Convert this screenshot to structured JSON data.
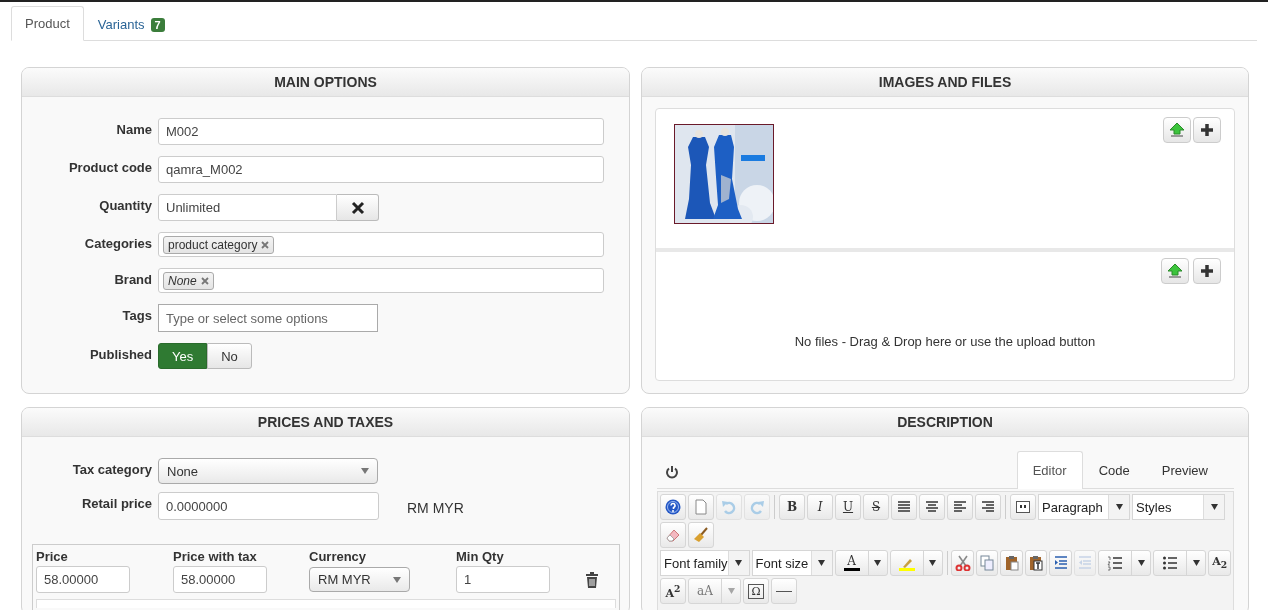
{
  "tabs": [
    {
      "label": "Product",
      "selected": true
    },
    {
      "label": "Variants",
      "selected": false,
      "badge": "7"
    }
  ],
  "main_options": {
    "title": "MAIN OPTIONS",
    "fields": [
      {
        "kind": "text",
        "label": "Name",
        "value": "M002"
      },
      {
        "kind": "text",
        "label": "Product code",
        "value": "qamra_M002"
      },
      {
        "kind": "clearable",
        "label": "Quantity",
        "value": "Unlimited"
      },
      {
        "kind": "tags",
        "label": "Categories",
        "tags": [
          {
            "text": "product category",
            "italic": false
          }
        ]
      },
      {
        "kind": "tags",
        "label": "Brand",
        "tags": [
          {
            "text": "None",
            "italic": true
          }
        ]
      },
      {
        "kind": "search",
        "label": "Tags",
        "placeholder": "Type or select some options"
      },
      {
        "kind": "toggle",
        "label": "Published",
        "options": [
          {
            "label": "Yes",
            "selected": true
          },
          {
            "label": "No",
            "selected": false
          }
        ]
      }
    ]
  },
  "images_and_files": {
    "title": "IMAGES AND FILES",
    "files_message": "No files - Drag & Drop here or use the upload button"
  },
  "prices_and_taxes": {
    "title": "PRICES AND TAXES",
    "tax_category": {
      "label": "Tax category",
      "value": "None"
    },
    "retail_price": {
      "label": "Retail price",
      "value": "0.0000000",
      "currency": "RM MYR"
    },
    "price_columns": [
      "Price",
      "Price with tax",
      "Currency",
      "Min Qty"
    ],
    "price_rows": [
      {
        "price": "58.00000",
        "price_with_tax": "58.00000",
        "currency": "RM MYR",
        "min_qty": "1"
      }
    ]
  },
  "description": {
    "title": "DESCRIPTION",
    "tabs": [
      {
        "label": "Editor",
        "selected": true
      },
      {
        "label": "Code",
        "selected": false
      },
      {
        "label": "Preview",
        "selected": false
      }
    ],
    "toolbar_lines": [
      [
        {
          "kind": "icon",
          "disabled": false
        },
        {
          "kind": "icon",
          "disabled": false
        },
        {
          "kind": "icon",
          "disabled": true
        },
        {
          "kind": "icon",
          "disabled": true
        },
        {
          "kind": "separator"
        },
        {
          "kind": "glyph",
          "text": "B",
          "disabled": false
        },
        {
          "kind": "glyph",
          "text": "I",
          "disabled": false
        },
        {
          "kind": "glyph",
          "text": "U",
          "disabled": false
        },
        {
          "kind": "glyph",
          "text": "S",
          "disabled": false
        },
        {
          "kind": "icon",
          "disabled": false
        },
        {
          "kind": "icon",
          "disabled": false
        },
        {
          "kind": "icon",
          "disabled": false
        },
        {
          "kind": "icon",
          "disabled": false
        },
        {
          "kind": "separator"
        },
        {
          "kind": "icon",
          "disabled": false
        },
        {
          "kind": "select",
          "value": "Paragraph"
        },
        {
          "kind": "select",
          "value": "Styles"
        }
      ],
      [
        {
          "kind": "icon",
          "disabled": false
        },
        {
          "kind": "icon",
          "disabled": false
        }
      ],
      [
        {
          "kind": "select",
          "value": "Font family"
        },
        {
          "kind": "select",
          "value": "Font size"
        },
        {
          "kind": "color-split",
          "text": "A",
          "color": "#000000",
          "disabled": false
        },
        {
          "kind": "color-split",
          "color": "#ffff00",
          "disabled": false
        },
        {
          "kind": "separator"
        },
        {
          "kind": "icon",
          "disabled": false
        },
        {
          "kind": "icon",
          "disabled": false
        },
        {
          "kind": "icon",
          "disabled": false
        },
        {
          "kind": "icon",
          "disabled": false
        },
        {
          "kind": "icon",
          "disabled": false
        },
        {
          "kind": "icon",
          "disabled": true
        },
        {
          "kind": "icon-split",
          "disabled": false
        },
        {
          "kind": "icon-split",
          "disabled": false
        },
        {
          "kind": "glyph",
          "text": "A$_{2}$",
          "disabled": false
        }
      ],
      [
        {
          "kind": "glyph",
          "text": "A$^{2}$",
          "disabled": false
        },
        {
          "kind": "glyph-split",
          "text": "aA",
          "disabled": true
        },
        {
          "kind": "glyph",
          "text": "Ω",
          "disabled": false
        },
        {
          "kind": "icon",
          "disabled": false
        }
      ]
    ]
  }
}
